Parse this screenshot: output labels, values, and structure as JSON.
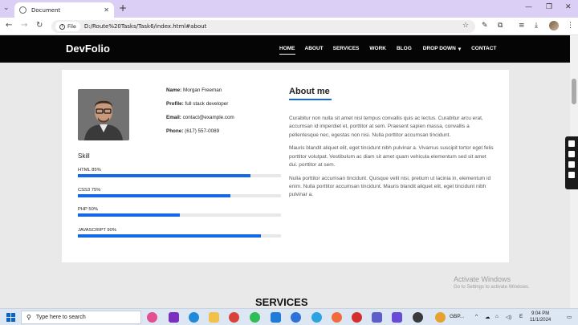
{
  "browser": {
    "tab_title": "Document",
    "new_tab": "+",
    "file_chip": "File",
    "url": "D:/Route%20Tasks/Task6/index.html#about"
  },
  "site": {
    "brand": "DevFolio",
    "nav": [
      "HOME",
      "ABOUT",
      "SERVICES",
      "WORK",
      "BLOG",
      "DROP DOWN",
      "CONTACT"
    ],
    "active_nav": "HOME"
  },
  "profile": {
    "name_label": "Name:",
    "name": "Morgan Freeman",
    "profile_label": "Profile:",
    "profile": "full stack developer",
    "email_label": "Email:",
    "email": "contact@example.com",
    "phone_label": "Phone:",
    "phone": "(617) 557-0089"
  },
  "skills": {
    "title": "Skill",
    "items": [
      {
        "label": "HTML 85%",
        "percent": 85
      },
      {
        "label": "CSS3 75%",
        "percent": 75
      },
      {
        "label": "PHP 50%",
        "percent": 50
      },
      {
        "label": "JAVASCRIPT 90%",
        "percent": 90
      }
    ]
  },
  "about": {
    "heading": "About me",
    "p1": "Curabitur non nulla sit amet nisl tempus convallis quis ac lectus. Curabitur arcu erat, accumsan id imperdiet et, porttitor at sem. Praesent sapien massa, convallis a pellentesque nec, egestas non nisi. Nulla porttitor accumsan tincidunt.",
    "p2": "Mauris blandit aliquet elit, eget tincidunt nibh pulvinar a. Vivamus suscipit tortor eget felis porttitor volutpat. Vestibulum ac diam sit amet quam vehicula elementum sed sit amet dui. porttitor at sem.",
    "p3": "Nulla porttitor accumsan tincidunt. Quisque velit nisi, pretium ut lacinia in, elementum id enim. Nulla porttitor accumsan tincidunt. Mauris blandit aliquet elit, eget tincidunt nibh pulvinar a."
  },
  "services_heading": "SERVICES",
  "watermark": {
    "line1": "Activate Windows",
    "line2": "Go to Settings to activate Windows."
  },
  "taskbar": {
    "search_placeholder": "Type here to search",
    "tray_app": "GBP...",
    "lang": "E",
    "time": "9:04 PM",
    "date": "11/1/2024"
  },
  "colors": {
    "accent": "#1169e8",
    "nav_bg": "#050505",
    "tab_strip": "#dccff6"
  }
}
